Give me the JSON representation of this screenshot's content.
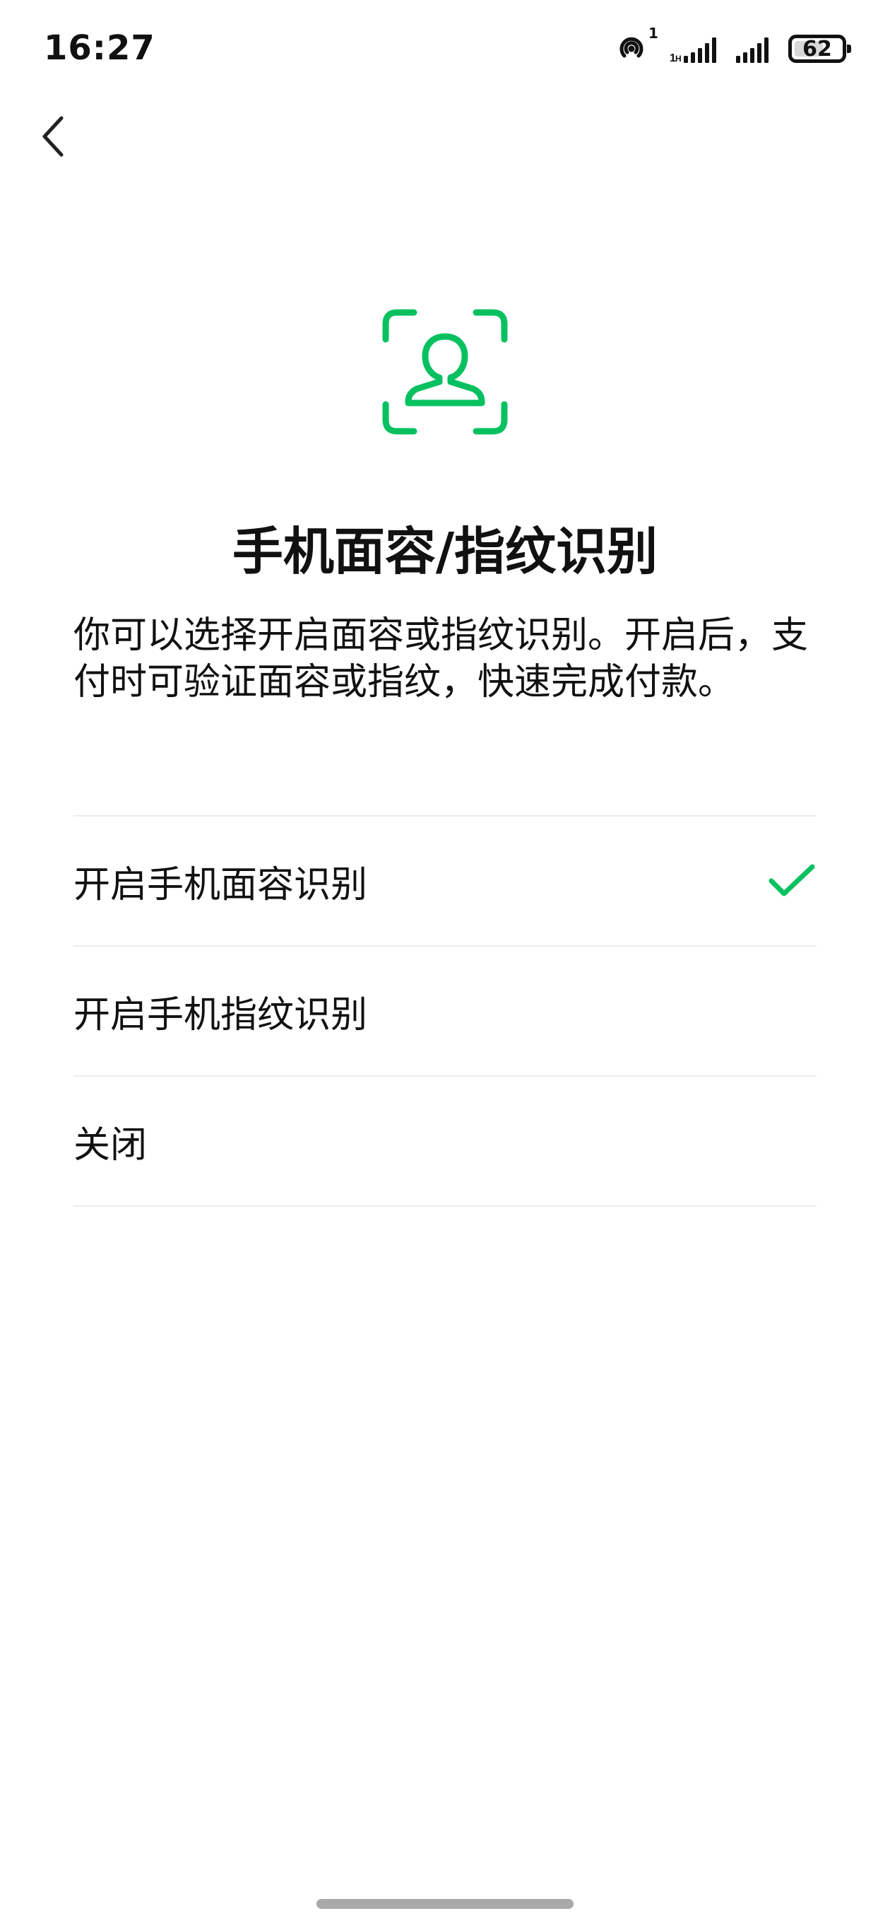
{
  "status_bar": {
    "time": "16:27",
    "hotspot_count": "1",
    "battery_level": "62",
    "battery_fraction": 0.62,
    "icons": [
      "hotspot-icon",
      "signal-sim1-icon",
      "signal-sim2-icon",
      "battery-icon"
    ]
  },
  "nav": {
    "back_icon": "chevron-left-icon"
  },
  "hero": {
    "icon": "face-recognition-icon",
    "title": "手机面容/指纹识别",
    "description": "你可以选择开启面容或指纹识别。开启后，支付时可验证面容或指纹，快速完成付款。"
  },
  "options": [
    {
      "label": "开启手机面容识别",
      "selected": true
    },
    {
      "label": "开启手机指纹识别",
      "selected": false
    },
    {
      "label": "关闭",
      "selected": false
    }
  ],
  "colors": {
    "accent": "#07c160",
    "text": "#111111",
    "divider": "#ececec",
    "background": "#ffffff"
  }
}
